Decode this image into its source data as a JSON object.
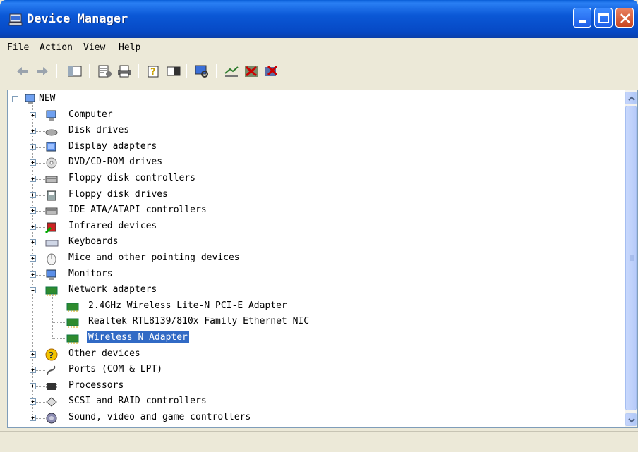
{
  "window": {
    "title": "Device Manager"
  },
  "menu": [
    "File",
    "Action",
    "View",
    "Help"
  ],
  "toolbar": {
    "icons": [
      "back-arrow-icon",
      "forward-arrow-icon",
      "show-hide-console-tree-icon",
      "properties-icon",
      "print-icon",
      "help-icon",
      "show-hide-action-pane-icon",
      "scan-hardware-icon",
      "update-driver-icon",
      "disable-device-icon",
      "uninstall-device-icon"
    ]
  },
  "tree": {
    "root": "NEW",
    "categories": [
      {
        "label": "Computer",
        "icon": "computer-icon",
        "expanded": false
      },
      {
        "label": "Disk drives",
        "icon": "disk-drive-icon",
        "expanded": false
      },
      {
        "label": "Display adapters",
        "icon": "display-adapter-icon",
        "expanded": false
      },
      {
        "label": "DVD/CD-ROM drives",
        "icon": "cdrom-icon",
        "expanded": false
      },
      {
        "label": "Floppy disk controllers",
        "icon": "controller-icon",
        "expanded": false
      },
      {
        "label": "Floppy disk drives",
        "icon": "floppy-drive-icon",
        "expanded": false
      },
      {
        "label": "IDE ATA/ATAPI controllers",
        "icon": "controller-icon",
        "expanded": false
      },
      {
        "label": "Infrared devices",
        "icon": "infrared-icon",
        "expanded": false
      },
      {
        "label": "Keyboards",
        "icon": "keyboard-icon",
        "expanded": false
      },
      {
        "label": "Mice and other pointing devices",
        "icon": "mouse-icon",
        "expanded": false
      },
      {
        "label": "Monitors",
        "icon": "monitor-icon",
        "expanded": false
      },
      {
        "label": "Network adapters",
        "icon": "network-adapter-icon",
        "expanded": true,
        "children": [
          {
            "label": "2.4GHz Wireless Lite-N PCI-E Adapter",
            "selected": false
          },
          {
            "label": "Realtek RTL8139/810x Family Ethernet NIC",
            "selected": false
          },
          {
            "label": "Wireless N Adapter",
            "selected": true
          }
        ]
      },
      {
        "label": "Other devices",
        "icon": "unknown-device-icon",
        "expanded": false
      },
      {
        "label": "Ports (COM & LPT)",
        "icon": "port-icon",
        "expanded": false
      },
      {
        "label": "Processors",
        "icon": "processor-icon",
        "expanded": false
      },
      {
        "label": "SCSI and RAID controllers",
        "icon": "scsi-icon",
        "expanded": false
      },
      {
        "label": "Sound, video and game controllers",
        "icon": "sound-icon",
        "expanded": false
      }
    ]
  },
  "colors": {
    "selection": "#316ac5",
    "titlebar": "#0b58d6",
    "chrome": "#ece9d8"
  }
}
